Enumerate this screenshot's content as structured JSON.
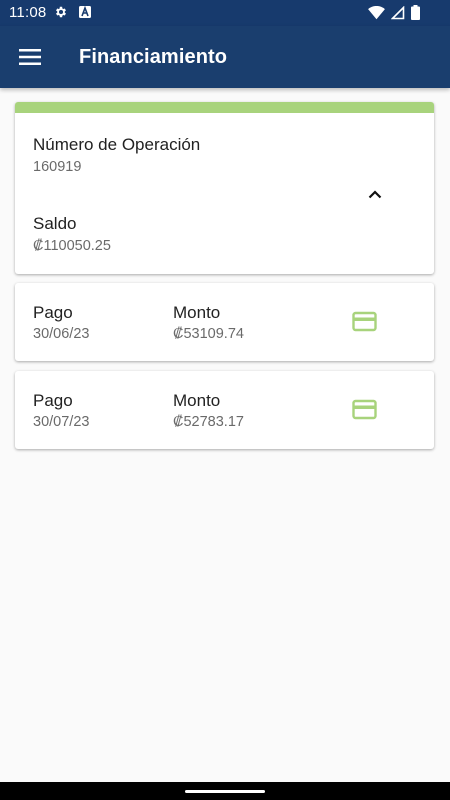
{
  "status_bar": {
    "time": "11:08",
    "icons_left": [
      "gear-icon",
      "a-notification-icon"
    ],
    "icons_right": [
      "wifi-icon",
      "signal-icon",
      "battery-icon"
    ]
  },
  "app_bar": {
    "title": "Financiamiento",
    "menu_icon": "hamburger-menu-icon",
    "background": "#1a3e6e"
  },
  "operation_card": {
    "accent_color": "#a8d37c",
    "operation_label": "Número de Operación",
    "operation_value": "160919",
    "balance_label": "Saldo",
    "balance_value": "₡110050.25",
    "collapse_icon": "chevron-up-icon"
  },
  "payments": [
    {
      "date_label": "Pago",
      "date_value": "30/06/23",
      "amount_label": "Monto",
      "amount_value": "₡53109.74",
      "icon": "credit-card-icon",
      "icon_color": "#a8d37c"
    },
    {
      "date_label": "Pago",
      "date_value": "30/07/23",
      "amount_label": "Monto",
      "amount_value": "₡52783.17",
      "icon": "credit-card-icon",
      "icon_color": "#a8d37c"
    }
  ]
}
